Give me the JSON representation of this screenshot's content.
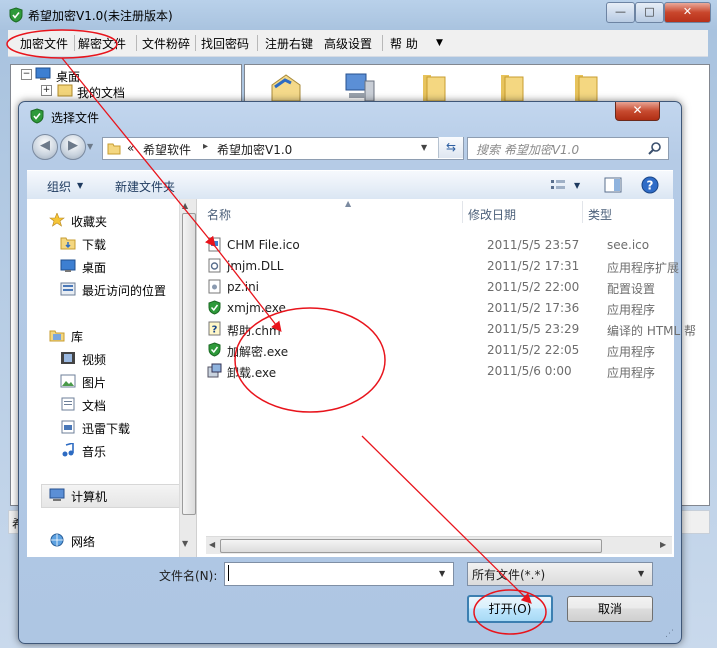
{
  "main_window": {
    "title": "希望加密V1.0(未注册版本)",
    "menu": [
      "加密文件",
      "解密文件",
      "文件粉碎",
      "找回密码",
      "注册右键",
      "高级设置",
      "帮 助"
    ],
    "tree": {
      "root": "桌面",
      "child": "我的文档"
    },
    "status_text": "希"
  },
  "dialog": {
    "title": "选择文件",
    "breadcrumb": [
      "«",
      "希望软件",
      "▸",
      "希望加密V1.0"
    ],
    "search_placeholder": "搜索 希望加密V1.0",
    "toolbar": {
      "organize": "组织",
      "new_folder": "新建文件夹"
    },
    "nav": {
      "favorites": "收藏夹",
      "fav_items": [
        "下载",
        "桌面",
        "最近访问的位置"
      ],
      "libraries": "库",
      "lib_items": [
        "视频",
        "图片",
        "文档",
        "迅雷下载",
        "音乐"
      ],
      "computer": "计算机",
      "network": "网络"
    },
    "columns": {
      "name": "名称",
      "date": "修改日期",
      "type": "类型"
    },
    "files": [
      {
        "name": "CHM File.ico",
        "date": "2011/5/5 23:57",
        "type": "see.ico",
        "icon": "ico-file-icon"
      },
      {
        "name": "jmjm.DLL",
        "date": "2011/5/2 17:31",
        "type": "应用程序扩展",
        "icon": "dll-file-icon"
      },
      {
        "name": "pz.ini",
        "date": "2011/5/2 22:00",
        "type": "配置设置",
        "icon": "ini-file-icon"
      },
      {
        "name": "xmjm.exe",
        "date": "2011/5/2 17:36",
        "type": "应用程序",
        "icon": "shield-exe-icon"
      },
      {
        "name": "帮助.chm",
        "date": "2011/5/5 23:29",
        "type": "编译的 HTML 帮",
        "icon": "chm-help-icon"
      },
      {
        "name": "加解密.exe",
        "date": "2011/5/2 22:05",
        "type": "应用程序",
        "icon": "shield-exe-icon"
      },
      {
        "name": "卸载.exe",
        "date": "2011/5/6 0:00",
        "type": "应用程序",
        "icon": "uninstall-exe-icon"
      }
    ],
    "filename_label": "文件名(N):",
    "filename_value": "",
    "filetype_value": "所有文件(*.*)",
    "open_button": "打开(O)",
    "cancel_button": "取消"
  },
  "colors": {
    "annotation": "#e8141c",
    "title_bar": "#b9d1ea",
    "open_button_border": "#3c7fb1"
  }
}
